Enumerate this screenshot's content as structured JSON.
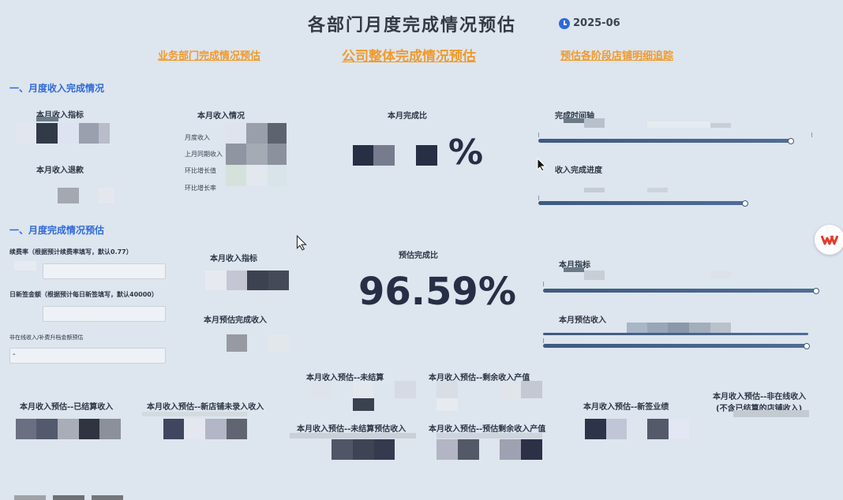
{
  "header": {
    "title": "各部门月度完成情况预估",
    "date": "2025-06"
  },
  "nav": {
    "business": "业务部门完成情况预估",
    "company": "公司整体完成情况预估",
    "stores": "预估各阶段店铺明细追踪"
  },
  "section1": {
    "title": "一、月度收入完成情况",
    "income_target_label": "本月收入指标",
    "refund_label": "本月收入退款",
    "income_status_label": "本月收入情况",
    "rows": [
      "月度收入",
      "上月同期收入",
      "环比增长值",
      "环比增长率"
    ],
    "ratio_label": "本月完成比",
    "ratio_suffix": "%",
    "timeline_label": "完成时间轴",
    "progress_label": "收入完成进度"
  },
  "section2": {
    "title": "一、月度完成情况预估",
    "renew_label": "续费率（根据预计续费率填写，默认0.77）",
    "daily_label": "日新签金额（根据预计每日新签填写，默认40000）",
    "offline_label": "非在线收入/补费升档金额预估",
    "offline_value": "-",
    "income_target_label": "本月收入指标",
    "forecast_label": "本月预估完成收入",
    "forecast_ratio_label": "预估完成比",
    "forecast_ratio_value": "96.59%",
    "month_target_label": "本月指标",
    "month_forecast_label": "本月预估收入"
  },
  "bottom": {
    "settled": "本月收入预估--已结算收入",
    "new_store": "本月收入预估--新店铺未录入收入",
    "unsettled": "本月收入预估--未结算",
    "unsettled_forecast": "本月收入预估--未结算预估收入",
    "remaining": "本月收入预估--剩余收入产值",
    "remaining_forecast": "本月收入预估--预估剩余收入产值",
    "new_sign": "本月收入预估--新签业绩",
    "offline_line1": "本月收入预估--非在线收入",
    "offline_line2": "(不含已结算的店铺收入)"
  },
  "wps_icon": "wps-logo-icon"
}
